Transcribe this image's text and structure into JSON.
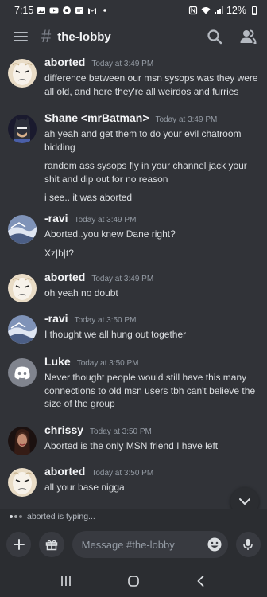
{
  "status_bar": {
    "time": "7:15",
    "battery": "12%",
    "left_icons": [
      "gallery-icon",
      "youtube-icon",
      "record-icon",
      "wrench-icon",
      "gmail-icon",
      "dot-icon"
    ],
    "right_icons": [
      "nfc-icon",
      "wifi-icon",
      "signal-icon",
      "battery-icon"
    ]
  },
  "header": {
    "channel_name": "the-lobby"
  },
  "messages": [
    {
      "author": "aborted",
      "time": "Today at 3:49 PM",
      "avatar": "aborted",
      "lines": [
        "difference between our msn sysops was they were all old, and here they're all weirdos and furries"
      ]
    },
    {
      "author": "Shane <mrBatman>",
      "time": "Today at 3:49 PM",
      "avatar": "batman",
      "lines": [
        "ah yeah and get them to do your evil chatroom bidding",
        "random ass sysops fly in your channel jack your shit and dip out for no reason",
        "i see.. it was aborted"
      ]
    },
    {
      "author": "-ravi",
      "time": "Today at 3:49 PM",
      "avatar": "ravi",
      "lines": [
        "Aborted..you knew Dane right?",
        "Xz|b|t?"
      ]
    },
    {
      "author": "aborted",
      "time": "Today at 3:49 PM",
      "avatar": "aborted",
      "lines": [
        "oh yeah no doubt"
      ]
    },
    {
      "author": "-ravi",
      "time": "Today at 3:50 PM",
      "avatar": "ravi",
      "lines": [
        "I thought we all hung out together"
      ]
    },
    {
      "author": "Luke",
      "time": "Today at 3:50 PM",
      "avatar": "discord",
      "lines": [
        "Never thought people would still have this many connections to old msn users tbh can't believe the size of the group"
      ]
    },
    {
      "author": "chrissy",
      "time": "Today at 3:50 PM",
      "avatar": "chrissy",
      "lines": [
        "Aborted is the only MSN friend I have left"
      ]
    },
    {
      "author": "aborted",
      "time": "Today at 3:50 PM",
      "avatar": "aborted",
      "lines": [
        "all your base nigga"
      ]
    }
  ],
  "typing": {
    "text": "aborted is typing..."
  },
  "composer": {
    "placeholder": "Message #the-lobby",
    "value": ""
  },
  "colors": {
    "background": "#313338",
    "bar": "#2b2d31",
    "input": "#383a40",
    "text": "#dbdee1",
    "muted": "#949ba4",
    "discord_blurple": "#5865f2"
  }
}
